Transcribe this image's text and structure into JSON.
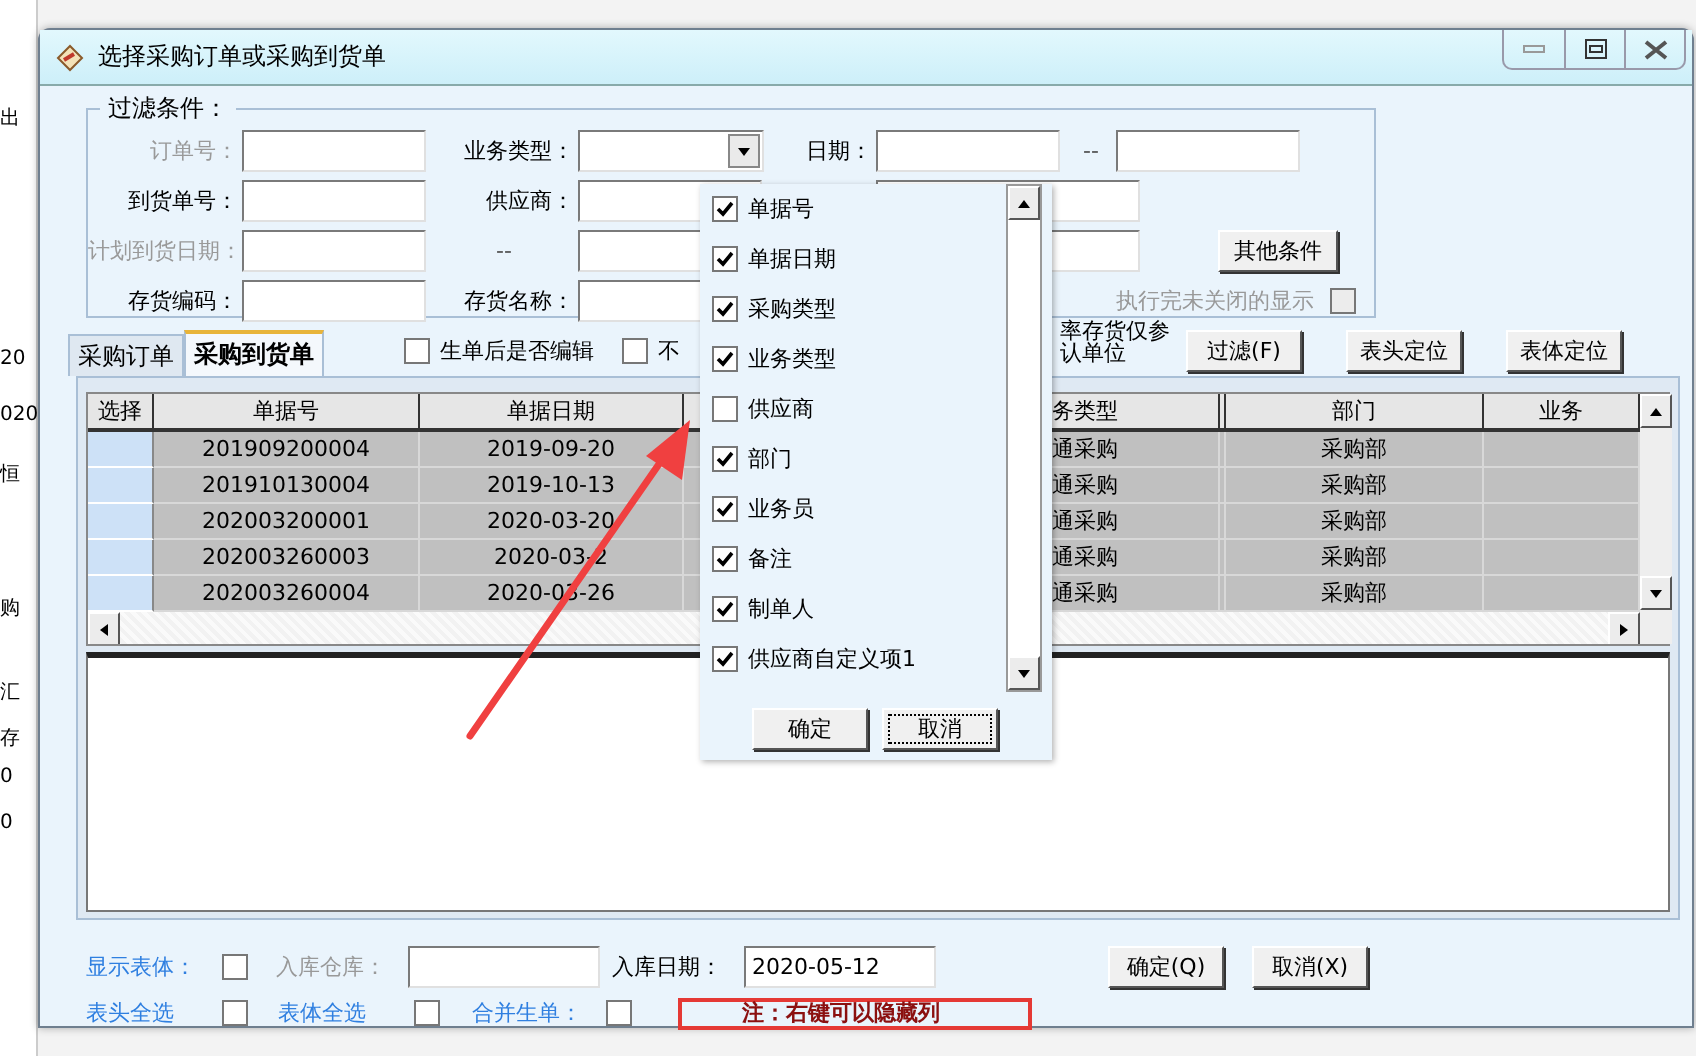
{
  "background_app": {
    "texts": [
      "出",
      "20",
      "020",
      "恒",
      "购",
      "汇",
      "存",
      "0",
      "0"
    ]
  },
  "window": {
    "title": "选择采购订单或采购到货单"
  },
  "filter": {
    "title": "过滤条件：",
    "fields": [
      {
        "kind": "text",
        "label": "订单号：",
        "disabled": true
      },
      {
        "kind": "dropdown",
        "label": "业务类型：",
        "disabled": false
      },
      {
        "kind": "range",
        "label": "日期：",
        "disabled": false,
        "separator": "--"
      },
      {
        "kind": "text",
        "label": "到货单号：",
        "disabled": false
      },
      {
        "kind": "text",
        "label": "供应商：",
        "disabled": false
      },
      {
        "kind": "bare_input"
      },
      {
        "kind": "range",
        "label": "计划到货日期：",
        "disabled": true,
        "separator": "--"
      },
      {
        "kind": "bare_input"
      },
      {
        "kind": "button",
        "label": "其他条件"
      },
      {
        "kind": "text",
        "label": "存货编码：",
        "disabled": false
      },
      {
        "kind": "text",
        "label": "存货名称：",
        "disabled": false
      },
      {
        "kind": "option",
        "label": "执行完未关闭的显示",
        "checked": false,
        "disabled": true
      }
    ]
  },
  "tabs": [
    {
      "label": "采购订单",
      "selected": false
    },
    {
      "label": "采购到货单",
      "selected": true
    }
  ],
  "options": [
    {
      "label": "生单后是否编辑",
      "checked": false
    },
    {
      "label": "不",
      "checked": false
    }
  ],
  "note_lines": [
    "率存货仅参",
    "认单位"
  ],
  "toolbar_buttons": [
    "过滤(F)",
    "表头定位",
    "表体定位"
  ],
  "table": {
    "selector_header": "选择",
    "columns": [
      "单据号",
      "单据日期",
      "务类型",
      "部门",
      "业务"
    ],
    "rows": [
      [
        "201909200004",
        "2019-09-20",
        "通采购",
        "采购部"
      ],
      [
        "201910130004",
        "2019-10-13",
        "通采购",
        "采购部"
      ],
      [
        "202003200001",
        "2020-03-20",
        "通采购",
        "采购部"
      ],
      [
        "202003260003",
        "2020-03-2",
        "通采购",
        "采购部"
      ],
      [
        "202003260004",
        "2020-03-26",
        "通采购",
        "采购部"
      ]
    ]
  },
  "footer": {
    "upper": [
      {
        "kind": "link",
        "text": "显示表体："
      },
      {
        "kind": "checkbox",
        "checked": false
      },
      {
        "kind": "label",
        "text": "入库仓库：",
        "disabled": true
      },
      {
        "kind": "input"
      },
      {
        "kind": "label",
        "text": "入库日期：",
        "disabled": false
      },
      {
        "kind": "input",
        "value": "2020-05-12"
      },
      {
        "kind": "button",
        "text": "确定(Q)"
      },
      {
        "kind": "button",
        "text": "取消(X)"
      }
    ],
    "lower": [
      {
        "kind": "link",
        "text": "表头全选"
      },
      {
        "kind": "checkbox",
        "checked": false
      },
      {
        "kind": "link",
        "text": "表体全选"
      },
      {
        "kind": "checkbox",
        "checked": false
      },
      {
        "kind": "link",
        "text": "合并生单："
      },
      {
        "kind": "checkbox",
        "checked": false
      },
      {
        "kind": "note",
        "text": "注：右键可以隐藏列"
      }
    ]
  },
  "column_menu": {
    "items": [
      {
        "label": "单据号",
        "checked": true
      },
      {
        "label": "单据日期",
        "checked": true
      },
      {
        "label": "采购类型",
        "checked": true
      },
      {
        "label": "业务类型",
        "checked": true
      },
      {
        "label": "供应商",
        "checked": false
      },
      {
        "label": "部门",
        "checked": true
      },
      {
        "label": "业务员",
        "checked": true
      },
      {
        "label": "备注",
        "checked": true
      },
      {
        "label": "制单人",
        "checked": true
      },
      {
        "label": "供应商自定义项1",
        "checked": true
      }
    ],
    "buttons": [
      "确定",
      "取消"
    ]
  }
}
